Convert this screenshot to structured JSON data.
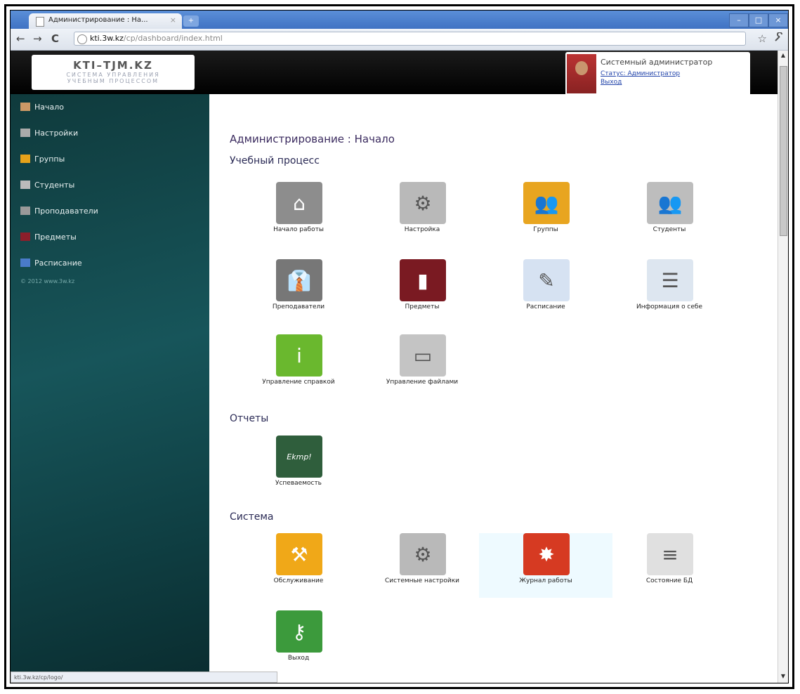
{
  "browser": {
    "tab_title": "Администрирование : На...",
    "tab_close": "×",
    "new_tab": "+",
    "url_host": "kti.3w.kz",
    "url_path": "/cp/dashboard/index.html",
    "win_min": "–",
    "win_max": "□",
    "win_close": "×",
    "back": "←",
    "forward": "→",
    "reload": "C",
    "star": "☆",
    "wrench": "🔧"
  },
  "header": {
    "logo_title": "KTI–TJM.KZ",
    "logo_sub1": "СИСТЕМА  УПРАВЛЕНИЯ",
    "logo_sub2": "УЧЕБНЫМ  ПРОЦЕССОМ",
    "user_name": "Системный администратор",
    "user_status": "Статус: Администратор",
    "logout": "Выход"
  },
  "sidebar": {
    "items": [
      {
        "label": "Начало",
        "color": "#c96"
      },
      {
        "label": "Настройки",
        "color": "#aaa"
      },
      {
        "label": "Группы",
        "color": "#e6a21a"
      },
      {
        "label": "Студенты",
        "color": "#bbb"
      },
      {
        "label": "Проподаватели",
        "color": "#999"
      },
      {
        "label": "Предметы",
        "color": "#8b1f2b"
      },
      {
        "label": "Расписание",
        "color": "#4a7bc9"
      }
    ],
    "copyright": "© 2012 www.3w.kz"
  },
  "main": {
    "page_title": "Администрирование : Начало",
    "section1": "Учебный процесс",
    "section2": "Отчеты",
    "section3": "Система",
    "tiles1": [
      {
        "label": "Начало работы",
        "icon": "home-icon",
        "glyph": "⌂",
        "bg": "#8d8d8d"
      },
      {
        "label": "Настройка",
        "icon": "gear-icon",
        "glyph": "⚙",
        "bg": "#b9b9b9"
      },
      {
        "label": "Группы",
        "icon": "group-icon",
        "glyph": "👥",
        "bg": "#e8a520"
      },
      {
        "label": "Студенты",
        "icon": "students-icon",
        "glyph": "👥",
        "bg": "#bdbdbd"
      },
      {
        "label": "Преподаватели",
        "icon": "teacher-suit-icon",
        "glyph": "👔",
        "bg": "#777"
      },
      {
        "label": "Предметы",
        "icon": "notebook-icon",
        "glyph": "▮",
        "bg": "#7a1a22"
      },
      {
        "label": "Расписание",
        "icon": "schedule-icon",
        "glyph": "✎",
        "bg": "#d6e2f2"
      },
      {
        "label": "Информация о себе",
        "icon": "profile-card-icon",
        "glyph": "☰",
        "bg": "#dde6f0"
      },
      {
        "label": "Управление справкой",
        "icon": "info-bubble-icon",
        "glyph": "i",
        "bg": "#6ab82e"
      },
      {
        "label": "Управление файлами",
        "icon": "monitor-icon",
        "glyph": "▭",
        "bg": "#c4c4c4"
      }
    ],
    "tiles2": [
      {
        "label": "Успеваемость",
        "icon": "chalkboard-icon",
        "glyph": "Ekmp!",
        "bg": "#2f5e3c"
      }
    ],
    "tiles3": [
      {
        "label": "Обслуживание",
        "icon": "maintenance-icon",
        "glyph": "⚒",
        "bg": "#f0a818"
      },
      {
        "label": "Системные настройки",
        "icon": "gear-icon",
        "glyph": "⚙",
        "bg": "#b9b9b9"
      },
      {
        "label": "Журнал работы",
        "icon": "alert-log-icon",
        "glyph": "✸",
        "bg": "#d63a22"
      },
      {
        "label": "Состояние БД",
        "icon": "database-icon",
        "glyph": "≡",
        "bg": "#e0e0e0"
      },
      {
        "label": "Выход",
        "icon": "key-icon",
        "glyph": "⚷",
        "bg": "#3c9a3c"
      }
    ]
  },
  "status": {
    "text": "kti.3w.kz/cp/logo/"
  }
}
